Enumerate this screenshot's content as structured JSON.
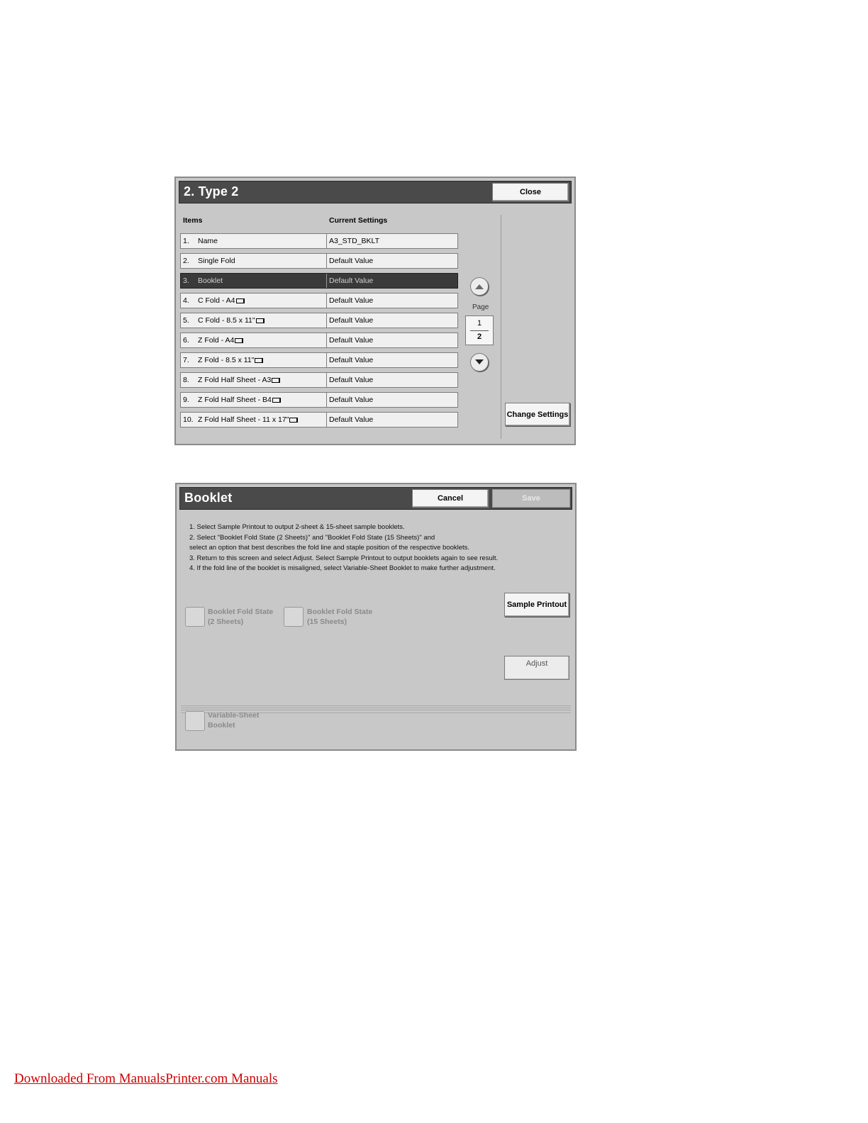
{
  "type_screen": {
    "title": "2. Type 2",
    "close_label": "Close",
    "col_items": "Items",
    "col_current": "Current Settings",
    "rows": [
      {
        "num": "1.",
        "label": "Name",
        "icon": false,
        "value": "A3_STD_BKLT"
      },
      {
        "num": "2.",
        "label": "Single Fold",
        "icon": false,
        "value": "Default Value"
      },
      {
        "num": "3.",
        "label": "Booklet",
        "icon": false,
        "value": "Default Value",
        "selected": true
      },
      {
        "num": "4.",
        "label": "C Fold - A4",
        "icon": true,
        "value": "Default Value"
      },
      {
        "num": "5.",
        "label": "C Fold - 8.5 x 11\"",
        "icon": true,
        "value": "Default Value"
      },
      {
        "num": "6.",
        "label": "Z Fold - A4",
        "icon": true,
        "value": "Default Value"
      },
      {
        "num": "7.",
        "label": "Z Fold - 8.5 x 11\"",
        "icon": true,
        "value": "Default Value"
      },
      {
        "num": "8.",
        "label": "Z Fold Half Sheet - A3",
        "icon": true,
        "value": "Default Value"
      },
      {
        "num": "9.",
        "label": "Z Fold Half Sheet - B4",
        "icon": true,
        "value": "Default Value"
      },
      {
        "num": "10.",
        "label": "Z Fold Half Sheet - 11 x 17\"",
        "icon": true,
        "value": "Default Value"
      }
    ],
    "page_label": "Page",
    "page_current": "1",
    "page_total": "2",
    "change_settings_label": "Change Settings",
    "icons": {
      "up": "chevron-up-icon",
      "down": "chevron-down-icon",
      "paper": "paper-orientation-icon"
    }
  },
  "booklet_screen": {
    "title": "Booklet",
    "cancel_label": "Cancel",
    "save_label": "Save",
    "instructions": [
      "1. Select Sample Printout to output 2-sheet & 15-sheet sample booklets.",
      "2. Select \"Booklet Fold State (2 Sheets)\" and \"Booklet Fold State (15 Sheets)\" and",
      "select an option that best describes the fold line and staple position of the respective booklets.",
      "3. Return to this screen and select Adjust. Select Sample Printout to output booklets again to see result.",
      "4. If the fold line of the booklet is misaligned, select Variable-Sheet Booklet to make further adjustment."
    ],
    "sample_printout_label": "Sample Printout",
    "adjust_label": "Adjust",
    "fold_state_2": {
      "line1": "Booklet Fold State",
      "line2": "(2 Sheets)"
    },
    "fold_state_15": {
      "line1": "Booklet Fold State",
      "line2": "(15 Sheets)"
    },
    "variable_sheet": {
      "line1": "Variable-Sheet",
      "line2": "Booklet"
    }
  },
  "footer": {
    "link_text": "Downloaded From ManualsPrinter.com Manuals"
  },
  "colors": {
    "titlebar": "#4a4a4a",
    "panel": "#c8c8c8",
    "selected_row": "#3a3a3a",
    "link": "#cc0000"
  }
}
